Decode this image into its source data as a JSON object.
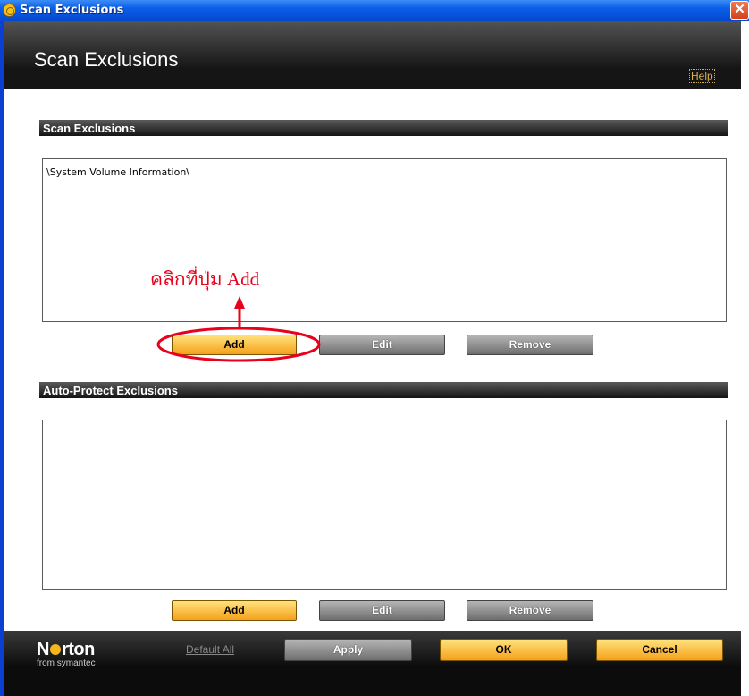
{
  "window": {
    "title": "Scan Exclusions",
    "close_glyph": "✕"
  },
  "header": {
    "title": "Scan Exclusions",
    "help": "Help"
  },
  "scan_exclusions": {
    "heading": "Scan Exclusions",
    "items": [
      "\\System Volume Information\\"
    ],
    "buttons": {
      "add": "Add",
      "edit": "Edit",
      "remove": "Remove"
    }
  },
  "auto_protect": {
    "heading": "Auto-Protect Exclusions",
    "items": [],
    "buttons": {
      "add": "Add",
      "edit": "Edit",
      "remove": "Remove"
    }
  },
  "annotation": {
    "text": "คลิกที่ปุ่ม Add",
    "color": "#e8001c"
  },
  "footer": {
    "brand": "Norton",
    "brand_sub": "from symantec",
    "default_all": "Default All",
    "apply": "Apply",
    "ok": "OK",
    "cancel": "Cancel"
  },
  "colors": {
    "accent_yellow": "#f6a01a",
    "titlebar_blue": "#0a5fe7",
    "annotation_red": "#e8001c"
  }
}
